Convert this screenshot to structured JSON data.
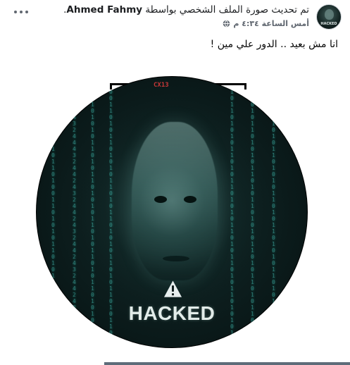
{
  "post": {
    "author": "Ahmed Fahmy",
    "headline_prefix": "تم تحديث صورة الملف الشخصي بواسطة",
    "headline_suffix": ".",
    "time": "أمس الساعة ٤:٣٤ م",
    "status": "انا مش بعيد .. الدور علي مين !",
    "more_icon": "more-options-icon",
    "globe_icon": "globe-icon"
  },
  "photo": {
    "overlay_text": "HACKED",
    "code_label": "CX13",
    "avatar_text": "HACKED"
  },
  "colors": {
    "text": "#050505",
    "muted": "#606770",
    "accent_red": "#c53737",
    "photo_dark": "#0d1f1f",
    "hacked_text": "#e2ece9"
  }
}
